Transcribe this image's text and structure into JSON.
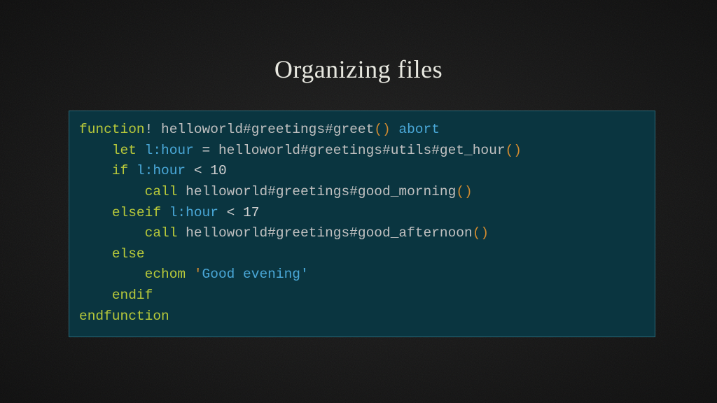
{
  "title": "Organizing files",
  "code": {
    "line1": {
      "kw": "function",
      "bang": "!",
      "sp1": " ",
      "name": "helloworld#greetings#greet",
      "paren": "()",
      "sp2": " ",
      "abort": "abort"
    },
    "line2": {
      "indent": "    ",
      "let": "let",
      "sp1": " ",
      "scope": "l:",
      "var": "hour",
      "sp2": " ",
      "eq": "=",
      "sp3": " ",
      "fn": "helloworld#greetings#utils#get_hour",
      "paren": "()"
    },
    "line3": {
      "indent": "    ",
      "if": "if",
      "sp1": " ",
      "scope": "l:",
      "var": "hour",
      "sp2": " ",
      "lt": "<",
      "sp3": " ",
      "num": "10"
    },
    "line4": {
      "indent": "        ",
      "call": "call",
      "sp1": " ",
      "fn": "helloworld#greetings#good_morning",
      "paren": "()"
    },
    "line5": {
      "indent": "    ",
      "elseif": "elseif",
      "sp1": " ",
      "scope": "l:",
      "var": "hour",
      "sp2": " ",
      "lt": "<",
      "sp3": " ",
      "num": "17"
    },
    "line6": {
      "indent": "        ",
      "call": "call",
      "sp1": " ",
      "fn": "helloworld#greetings#good_afternoon",
      "paren": "()"
    },
    "line7": {
      "indent": "    ",
      "else": "else"
    },
    "line8": {
      "indent": "        ",
      "echom": "echom",
      "sp1": " ",
      "q": "'",
      "body": "Good evening'"
    },
    "line9": {
      "indent": "    ",
      "endif": "endif"
    },
    "line10": {
      "endfunc": "endfunction"
    }
  }
}
